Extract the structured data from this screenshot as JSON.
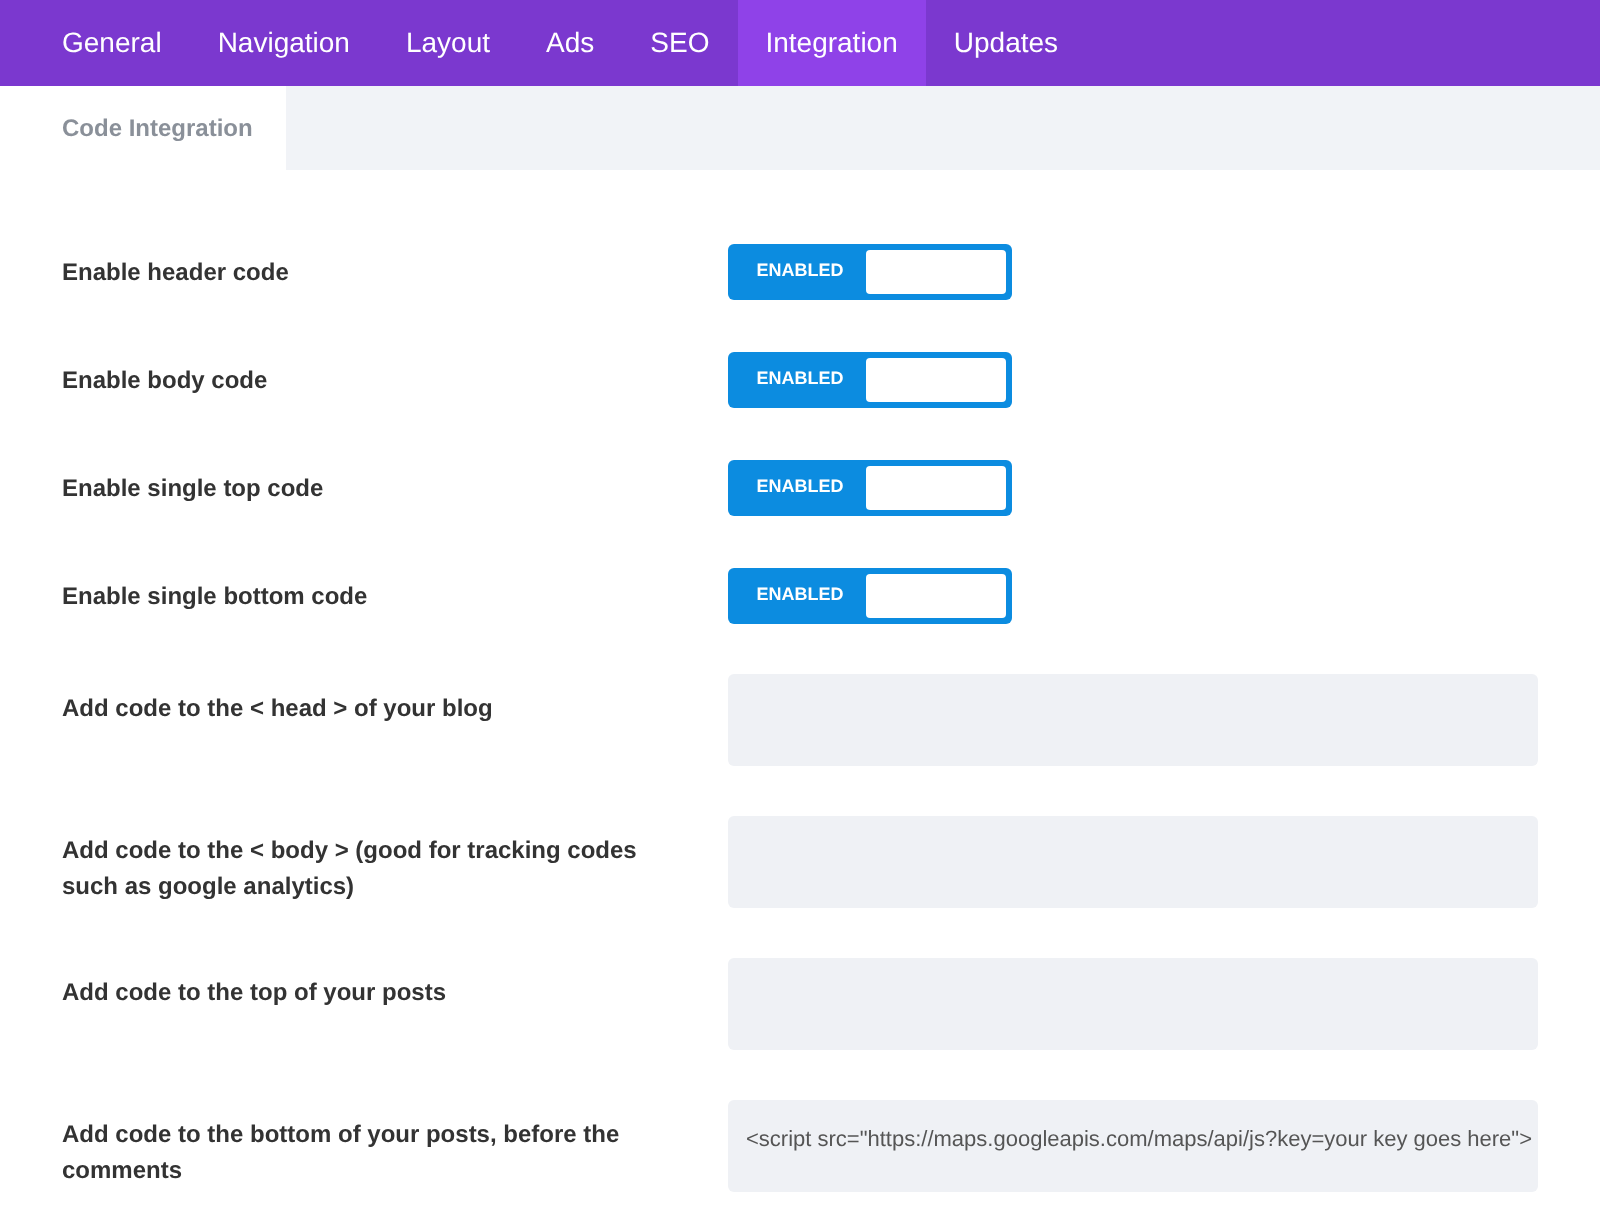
{
  "tabs": [
    {
      "label": "General",
      "selected": false
    },
    {
      "label": "Navigation",
      "selected": false
    },
    {
      "label": "Layout",
      "selected": false
    },
    {
      "label": "Ads",
      "selected": false
    },
    {
      "label": "SEO",
      "selected": false
    },
    {
      "label": "Integration",
      "selected": true
    },
    {
      "label": "Updates",
      "selected": false
    }
  ],
  "subtabs": [
    {
      "label": "Code Integration",
      "selected": true
    }
  ],
  "settings": [
    {
      "kind": "toggle",
      "label": "Enable header code",
      "toggle": {
        "on": true,
        "label": "ENABLED"
      }
    },
    {
      "kind": "toggle",
      "label": "Enable body code",
      "toggle": {
        "on": true,
        "label": "ENABLED"
      }
    },
    {
      "kind": "toggle",
      "label": "Enable single top code",
      "toggle": {
        "on": true,
        "label": "ENABLED"
      }
    },
    {
      "kind": "toggle",
      "label": "Enable single bottom code",
      "toggle": {
        "on": true,
        "label": "ENABLED"
      }
    },
    {
      "kind": "code",
      "label": "Add code to the < head > of your blog"
    },
    {
      "kind": "code",
      "label": "Add code to the < body > (good for tracking codes such as google analytics)"
    },
    {
      "kind": "code",
      "label": "Add code to the top of your posts"
    },
    {
      "kind": "code",
      "label": "Add code to the bottom of your posts, before the comments",
      "value": "<script src=\"https://maps.googleapis.com/maps/api/js?key=your key goes here\">"
    }
  ]
}
